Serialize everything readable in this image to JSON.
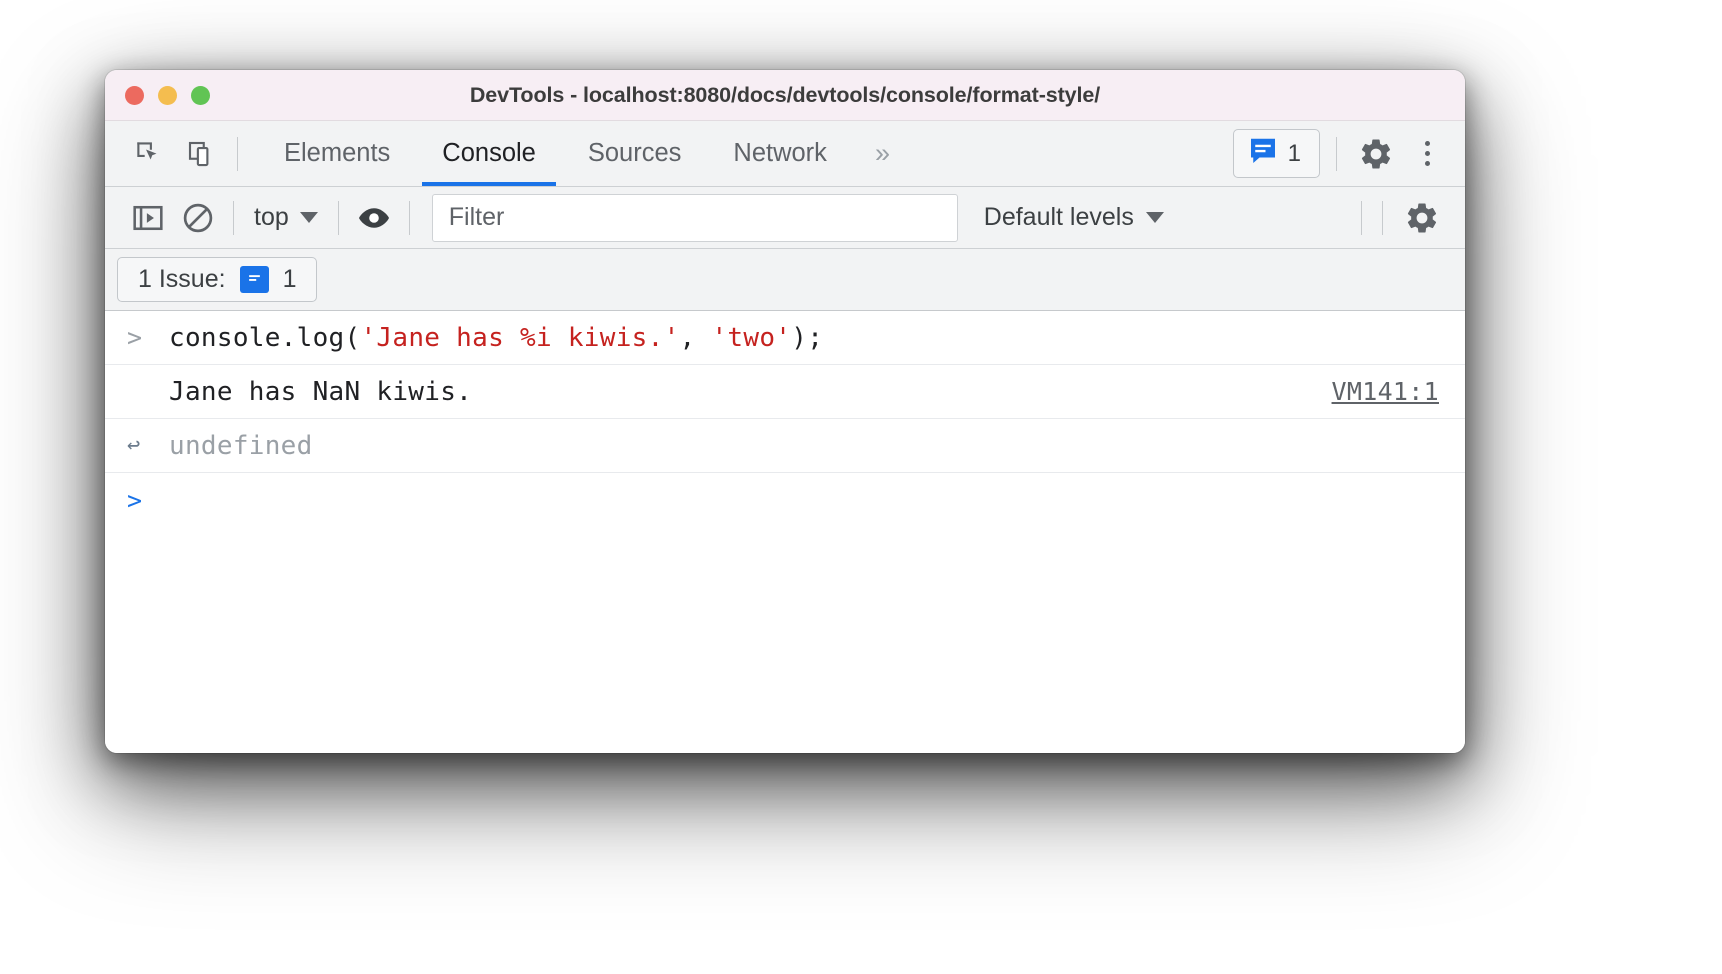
{
  "window": {
    "title": "DevTools - localhost:8080/docs/devtools/console/format-style/",
    "traffic_lights": {
      "close": "close-button",
      "minimize": "minimize-button",
      "maximize": "maximize-button"
    }
  },
  "tabbar": {
    "left_icons": [
      {
        "name": "inspect-element-icon",
        "label": "Inspect element"
      },
      {
        "name": "device-toolbar-icon",
        "label": "Toggle device toolbar"
      }
    ],
    "tabs": [
      {
        "label": "Elements",
        "active": false
      },
      {
        "label": "Console",
        "active": true
      },
      {
        "label": "Sources",
        "active": false
      },
      {
        "label": "Network",
        "active": false
      }
    ],
    "more_tabs": "»",
    "issues_count": "1",
    "settings_label": "Settings",
    "menu_label": "Customize and control DevTools"
  },
  "console_toolbar": {
    "sidebar_toggle_label": "Show console sidebar",
    "clear_label": "Clear console",
    "context": "top",
    "eye_label": "Create live expression",
    "filter": {
      "placeholder": "Filter",
      "value": ""
    },
    "levels": "Default levels",
    "settings_label": "Console settings"
  },
  "issues_bar": {
    "label": "1 Issue:",
    "count": "1"
  },
  "console": {
    "rows": [
      {
        "kind": "input",
        "gutter": ">",
        "code_before": "console.log(",
        "code_string1": "'Jane has %i kiwis.'",
        "code_middle": ", ",
        "code_string2": "'two'",
        "code_after": ");"
      },
      {
        "kind": "output",
        "text": "Jane has NaN kiwis.",
        "source": "VM141:1"
      },
      {
        "kind": "result",
        "gutter": "↩",
        "text": "undefined"
      },
      {
        "kind": "prompt",
        "gutter": ">"
      }
    ]
  },
  "colors": {
    "accent": "#1a73e8",
    "string": "#c5221f",
    "titlebar": "#f7eef4",
    "toolbar": "#f2f3f4"
  }
}
